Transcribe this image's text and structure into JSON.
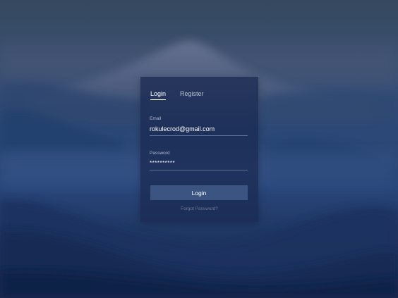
{
  "tabs": {
    "login_label": "Login",
    "register_label": "Register"
  },
  "email": {
    "label": "Email",
    "value": "rokulecrod@gmail.com"
  },
  "password": {
    "label": "Password",
    "value": "**********"
  },
  "submit_label": "Login",
  "forgot_label": "Forgot Password?",
  "colors": {
    "card_background": "#1c2c54",
    "button_background": "#3b5482",
    "active_tab": "#ffffff",
    "muted_text": "#6d7a95"
  }
}
